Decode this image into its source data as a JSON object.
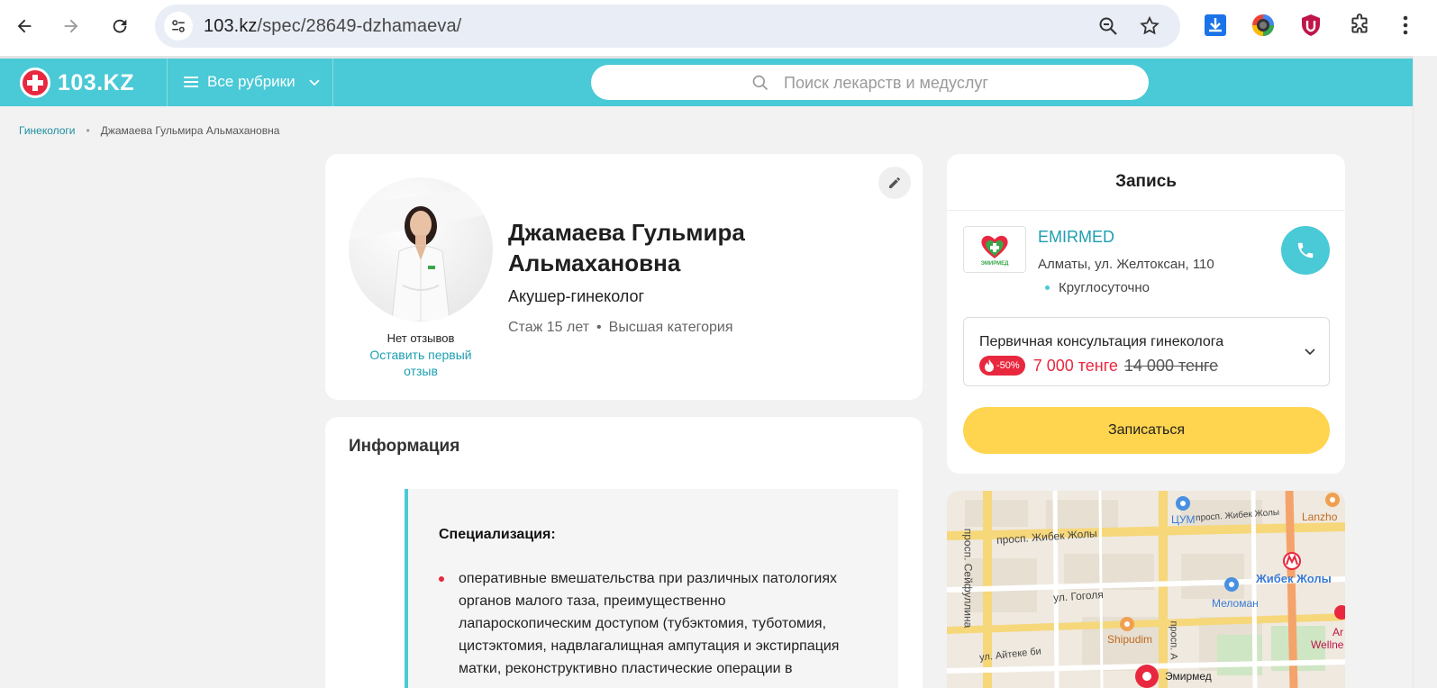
{
  "browser": {
    "url_host": "103.kz",
    "url_path": "/spec/28649-dzhamaeva/"
  },
  "header": {
    "logo_text": "103.KZ",
    "rubrics_label": "Все рубрики",
    "search_placeholder": "Поиск лекарств и медуслуг",
    "accent_color": "#4ac9d6"
  },
  "breadcrumb": {
    "parent": "Гинекологи",
    "separator": "•",
    "current": "Джамаева Гульмира Альмахановна"
  },
  "profile": {
    "name": "Джамаева Гульмира Альмахановна",
    "specialty": "Акушер-гинеколог",
    "experience": "Стаж 15 лет",
    "meta_separator": "•",
    "category": "Высшая категория",
    "reviews_none": "Нет отзывов",
    "review_link": "Оставить первый отзыв"
  },
  "info": {
    "title": "Информация",
    "section_heading": "Специализация:",
    "items": [
      "оперативные вмешательства при различных патологиях органов малого таза, преимущественно лапароскопическим доступом (тубэктомия, туботомия, цистэктомия, надвлагалищная ампутация и экстирпация матки, реконструктивно пластические операции в"
    ]
  },
  "booking": {
    "title": "Запись",
    "clinic_name": "EMIRMED",
    "clinic_address": "Алматы, ул. Желтоксан, 110",
    "clinic_hours": "Круглосуточно",
    "service_name": "Первичная консультация гинеколога",
    "discount": "-50%",
    "price_new": "7 000 тенге",
    "price_old": "14 000 тенге",
    "book_button": "Записаться",
    "button_color": "#ffd44f",
    "sale_color": "#e8283f"
  },
  "map": {
    "labels": {
      "zhibek_top": "просп. Жибек Жолы",
      "tsum": "ЦУМ",
      "zhibek_right": "просп. Жибек Жолы",
      "seifullina": "просп. Сейфуллина",
      "lanzhou": "Lanzho",
      "gogolya": "ул. Гоголя",
      "meloman": "Меломан",
      "zhibek_station": "Жибек Жолы",
      "shipudim": "Shipudim",
      "aytiev": "ул. Айтеке би",
      "prosp_a": "просп. А",
      "wellne": "Wellne",
      "ara": "Ar",
      "emirmed": "Эмирмед"
    }
  }
}
